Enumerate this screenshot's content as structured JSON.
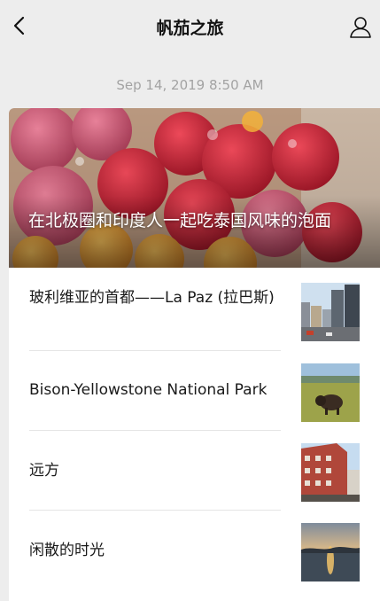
{
  "nav": {
    "title": "帆茄之旅",
    "back_icon": "chevron-left-icon",
    "profile_icon": "person-icon"
  },
  "timestamp": "Sep 14, 2019 8:50 AM",
  "hero": {
    "title": "在北极圈和印度人一起吃泰国风味的泡面"
  },
  "articles": [
    {
      "title": "玻利维亚的首都——La Paz (拉巴斯)"
    },
    {
      "title": "Bison-Yellowstone National Park"
    },
    {
      "title": "远方"
    },
    {
      "title": "闲散的时光"
    }
  ],
  "colors": {
    "background": "#ededed",
    "card": "#ffffff",
    "timestamp": "#a3a3a3"
  }
}
